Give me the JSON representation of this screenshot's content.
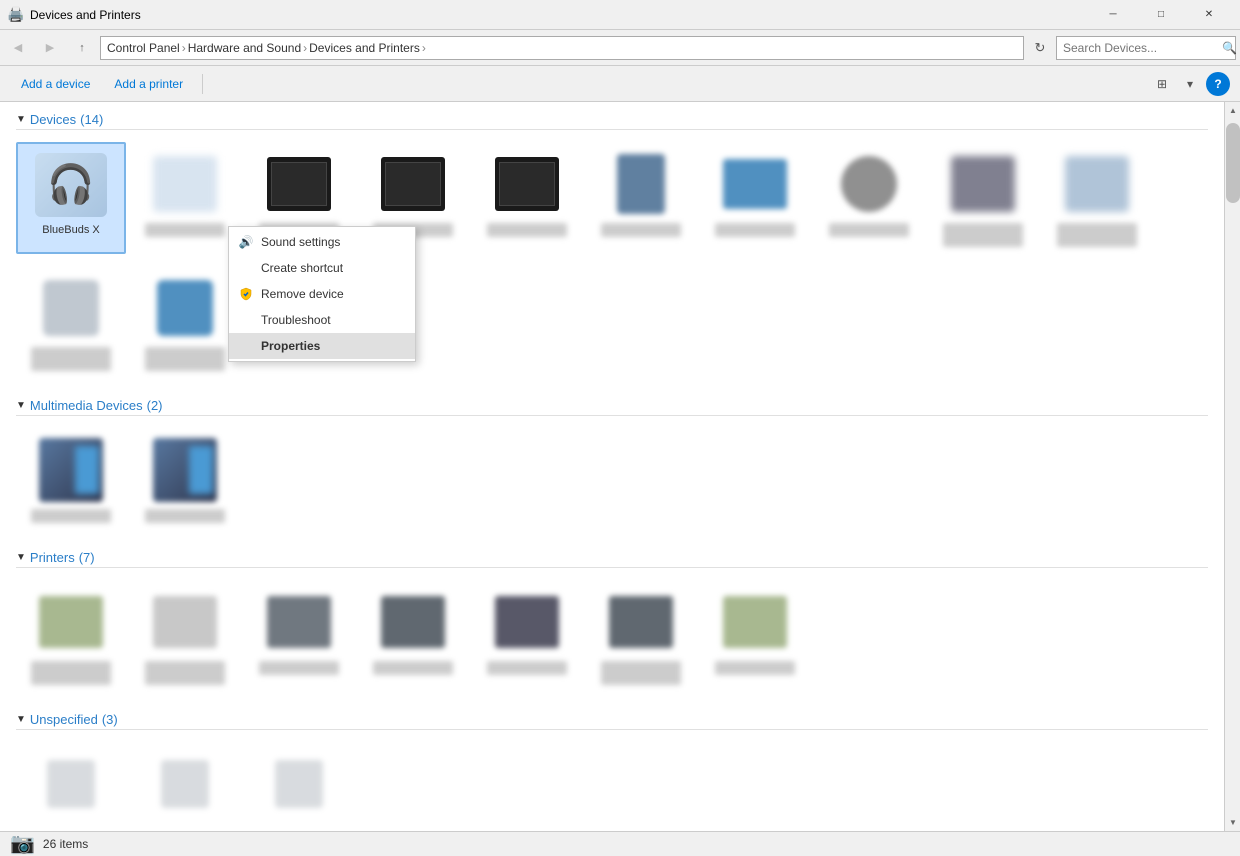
{
  "window": {
    "title": "Devices and Printers",
    "icon": "🖨️"
  },
  "titlebar": {
    "minimize_label": "─",
    "maximize_label": "□",
    "close_label": "✕"
  },
  "addressbar": {
    "back_label": "◀",
    "forward_label": "▶",
    "up_label": "↑",
    "path": [
      "Control Panel",
      "Hardware and Sound",
      "Devices and Printers"
    ],
    "search_placeholder": "Search Devices...",
    "search_icon": "🔍",
    "refresh_label": "↻"
  },
  "toolbar": {
    "add_device_label": "Add a device",
    "add_printer_label": "Add a printer",
    "view_label": "⊞",
    "view_arrow_label": "▾",
    "help_label": "?"
  },
  "sections": {
    "devices": {
      "title": "Devices",
      "count": "(14)",
      "items": [
        {
          "name": "BlueBuds X",
          "type": "bluetooth-headset",
          "selected": true
        },
        {
          "name": "",
          "type": "blurred"
        },
        {
          "name": "",
          "type": "monitor-black"
        },
        {
          "name": "",
          "type": "monitor-black"
        },
        {
          "name": "",
          "type": "monitor-black"
        },
        {
          "name": "",
          "type": "computer-tower"
        },
        {
          "name": "",
          "type": "laptop"
        },
        {
          "name": "",
          "type": "webcam"
        },
        {
          "name": "",
          "type": "blurred-dark"
        },
        {
          "name": "",
          "type": "blurred-gray"
        }
      ],
      "row2": [
        {
          "name": "",
          "type": "headset-white"
        },
        {
          "name": "",
          "type": "headset-blue"
        }
      ]
    },
    "multimedia": {
      "title": "Multimedia Devices",
      "count": "(2)",
      "items": [
        {
          "name": "",
          "type": "multimedia1"
        },
        {
          "name": "",
          "type": "multimedia2"
        }
      ]
    },
    "printers": {
      "title": "Printers",
      "count": "(7)",
      "items": [
        {
          "name": "",
          "type": "printer1"
        },
        {
          "name": "",
          "type": "printer2"
        },
        {
          "name": "",
          "type": "printer3"
        },
        {
          "name": "",
          "type": "printer4"
        },
        {
          "name": "",
          "type": "printer5"
        },
        {
          "name": "",
          "type": "printer6"
        },
        {
          "name": "",
          "type": "printer7"
        }
      ]
    },
    "unspecified": {
      "title": "Unspecified",
      "count": "(3)"
    }
  },
  "context_menu": {
    "items": [
      {
        "label": "Sound settings",
        "icon": "🔊",
        "type": "item"
      },
      {
        "label": "Create shortcut",
        "icon": "",
        "type": "item"
      },
      {
        "label": "Remove device",
        "icon": "shield",
        "type": "item"
      },
      {
        "label": "Troubleshoot",
        "icon": "",
        "type": "item"
      },
      {
        "label": "Properties",
        "icon": "",
        "type": "highlighted"
      }
    ]
  },
  "statusbar": {
    "count": "26 items",
    "camera_icon": "📷"
  }
}
